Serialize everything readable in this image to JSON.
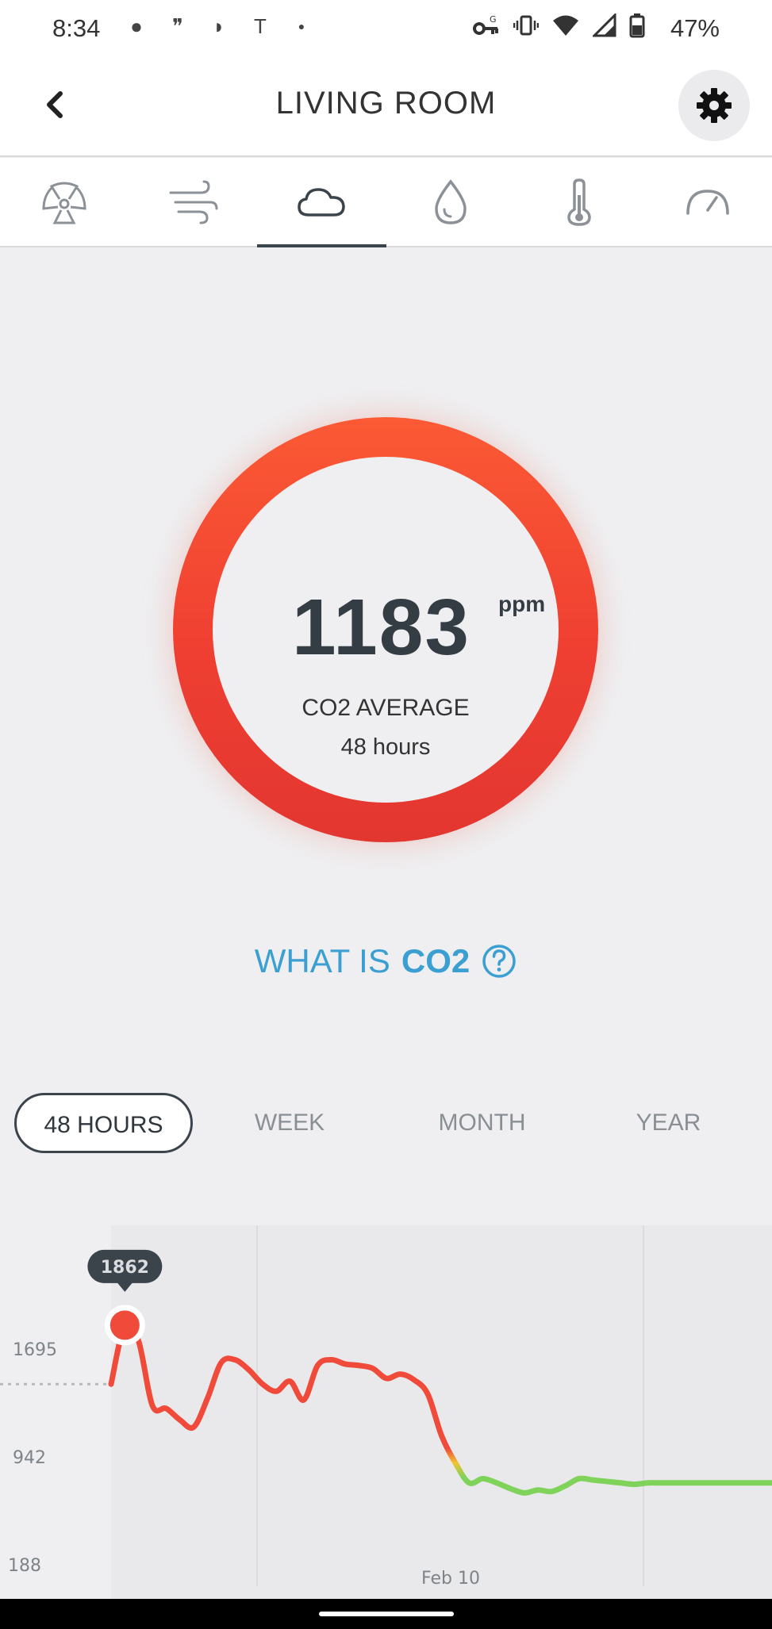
{
  "status_bar": {
    "time": "8:34",
    "battery": "47%"
  },
  "header": {
    "title": "LIVING ROOM"
  },
  "tabs": [
    {
      "icon": "radiation-icon",
      "active": false
    },
    {
      "icon": "wind-icon",
      "active": false
    },
    {
      "icon": "cloud-icon",
      "active": true
    },
    {
      "icon": "droplet-icon",
      "active": false
    },
    {
      "icon": "thermometer-icon",
      "active": false
    },
    {
      "icon": "gauge-icon",
      "active": false
    }
  ],
  "gauge": {
    "value": "1183",
    "unit": "ppm",
    "label": "CO2 AVERAGE",
    "sub": "48 hours",
    "color": "#ef4433"
  },
  "what_is": {
    "prefix": "WHAT IS",
    "term": "CO2",
    "color": "#3b9fd2"
  },
  "periods": {
    "hours": "48 HOURS",
    "week": "WEEK",
    "month": "MONTH",
    "year": "YEAR",
    "selected": "48 HOURS"
  },
  "chart_data": {
    "type": "line",
    "y_ticks": [
      188,
      942,
      1695
    ],
    "ylim": [
      0,
      2000
    ],
    "x_label": "Feb 10",
    "tooltip": "1862",
    "threshold_value": 1450,
    "colors": {
      "high": "#ef4a3a",
      "mid": "#f2c430",
      "low": "#7fd35a"
    },
    "series": [
      {
        "x": [
          0,
          1,
          2,
          3,
          4,
          5,
          6,
          7,
          8,
          9,
          10,
          11,
          12,
          13,
          14,
          15,
          16,
          17,
          18,
          19,
          20,
          21,
          22,
          23,
          24,
          25,
          26,
          27,
          28,
          29,
          30,
          31,
          32,
          33,
          34,
          35,
          36,
          37,
          38,
          39,
          40,
          41,
          42,
          43,
          44,
          45,
          46,
          47,
          48
        ],
        "y": [
          1450,
          1862,
          1750,
          1300,
          1280,
          1200,
          1150,
          1350,
          1600,
          1620,
          1550,
          1450,
          1400,
          1470,
          1340,
          1580,
          1620,
          1590,
          1580,
          1560,
          1490,
          1520,
          1480,
          1380,
          1090,
          900,
          760,
          790,
          760,
          720,
          690,
          710,
          700,
          740,
          790,
          780,
          770,
          760,
          750,
          760,
          760,
          760,
          760,
          760,
          760,
          760,
          760,
          760,
          760
        ]
      }
    ]
  }
}
